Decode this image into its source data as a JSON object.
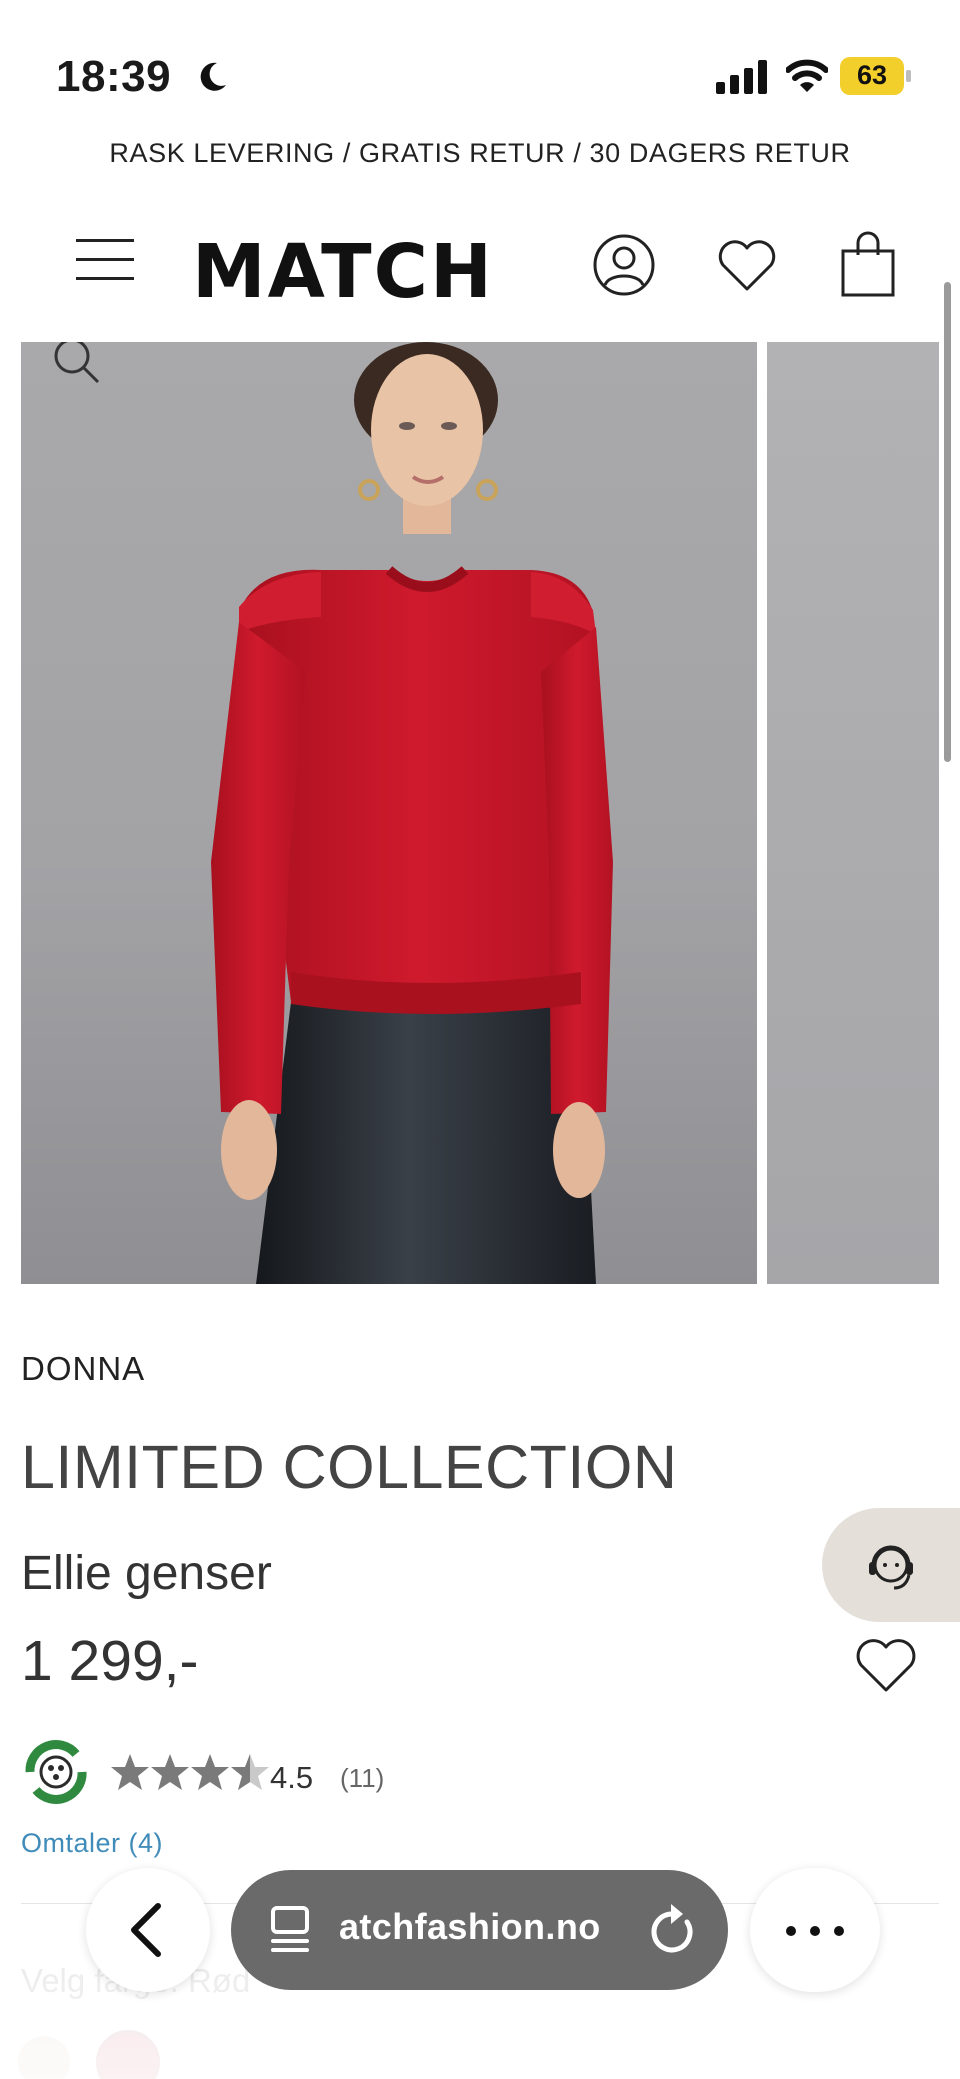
{
  "status_bar": {
    "time": "18:39",
    "battery": "63"
  },
  "promo": {
    "text": "RASK LEVERING / GRATIS RETUR / 30 DAGERS RETUR"
  },
  "header": {
    "logo": "MATCH"
  },
  "product": {
    "brand": "DONNA",
    "collection": "LIMITED COLLECTION",
    "name": "Ellie genser",
    "price": "1 299,-",
    "rating": {
      "value": 4.5,
      "value_text": "4.5",
      "count": "(11)"
    },
    "reviews_link": "Omtaler (4)",
    "color_label": "Velg farge: Rød",
    "colors": {
      "sweater": "#c8172a",
      "pants": "#1f2328",
      "accent_link": "#3d8ab8"
    }
  },
  "browser": {
    "url": "atchfashion.no"
  }
}
